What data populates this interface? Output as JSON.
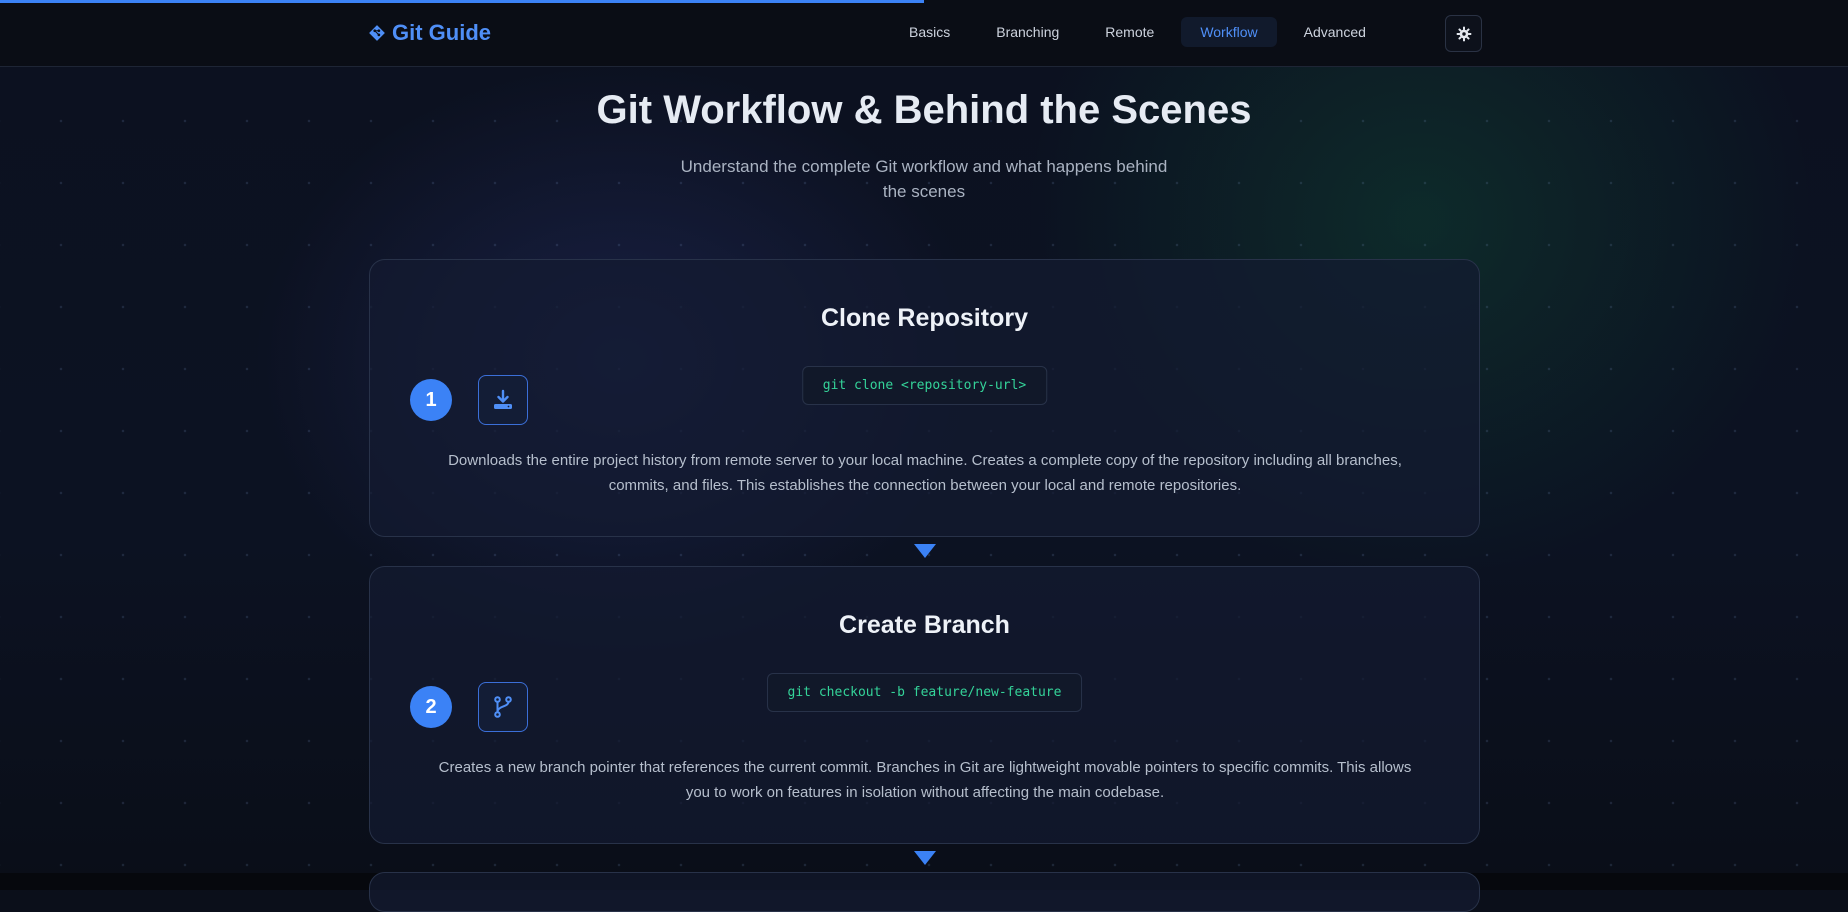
{
  "header": {
    "brand": "Git Guide",
    "nav": [
      {
        "label": "Basics",
        "active": false
      },
      {
        "label": "Branching",
        "active": false
      },
      {
        "label": "Remote",
        "active": false
      },
      {
        "label": "Workflow",
        "active": true
      },
      {
        "label": "Advanced",
        "active": false
      }
    ],
    "theme_icon": "gear-icon"
  },
  "scroll_progress_fraction": 0.5,
  "hero": {
    "title": "Git Workflow & Behind the Scenes",
    "subtitle": "Understand the complete Git workflow and what happens behind the scenes"
  },
  "steps": [
    {
      "number": "1",
      "title": "Clone Repository",
      "command": "git clone <repository-url>",
      "icon": "download-icon",
      "description": "Downloads the entire project history from remote server to your local machine. Creates a complete copy of the repository including all branches, commits, and files. This establishes the connection between your local and remote repositories."
    },
    {
      "number": "2",
      "title": "Create Branch",
      "command": "git checkout -b feature/new-feature",
      "icon": "branch-icon",
      "description": "Creates a new branch pointer that references the current commit. Branches in Git are lightweight movable pointers to specific commits. This allows you to work on features in isolation without affecting the main codebase."
    }
  ],
  "colors": {
    "accent": "#3b82f6",
    "command_text": "#34d399",
    "background": "#0b0f1a"
  }
}
